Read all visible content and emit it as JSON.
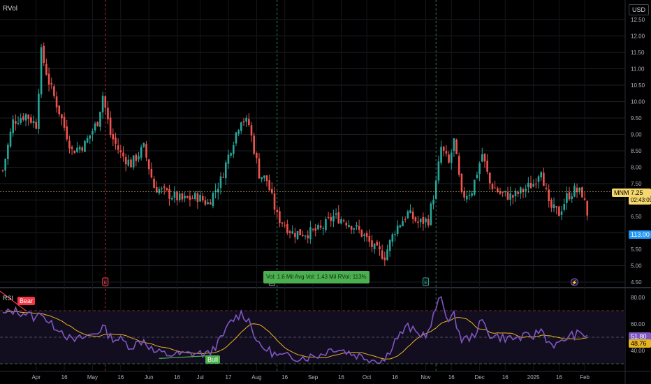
{
  "indicator_labels": {
    "main": "RVol",
    "sub": "RSI"
  },
  "currency": "USD",
  "price_tag": {
    "symbol": "MNMD",
    "price": "7.25",
    "countdown": "02:43:09",
    "color": "#f5d76e"
  },
  "volume_tag": {
    "value": "113.00",
    "color": "#2196f3"
  },
  "rvol_box": {
    "text": "Vol: 1.6 Mil   Avg Vol: 1.43 Mil   RVol: 113%",
    "color": "#4caf50"
  },
  "rsi_tags": {
    "value": "51.80",
    "ma": "48.76",
    "value_color": "#7e57c2",
    "ma_color": "#e6b422"
  },
  "annotations": {
    "bear": "Bear",
    "bull": "Bull",
    "bear_color": "#f23645",
    "bull_color": "#4caf50"
  },
  "event_markers": [
    {
      "kind": "earnings",
      "glyph": "E",
      "color": "#f23645",
      "index": 40
    },
    {
      "kind": "earnings",
      "glyph": "E",
      "color": "#9598a1",
      "index": 105
    },
    {
      "kind": "earnings",
      "glyph": "E",
      "color": "#26a69a",
      "index": 165
    },
    {
      "kind": "split",
      "glyph": "⚡",
      "color": "#7e57c2",
      "index": 223
    }
  ],
  "chart_data": {
    "type": "candlestick",
    "price_axis": {
      "min": 4.5,
      "max": 12.5,
      "step": 0.5,
      "ticks": [
        "12.50",
        "12.00",
        "11.50",
        "11.00",
        "10.50",
        "10.00",
        "9.50",
        "9.00",
        "8.50",
        "8.00",
        "7.50",
        "7.00",
        "6.50",
        "6.00",
        "5.50",
        "5.00",
        "4.50"
      ]
    },
    "rsi_axis": {
      "ticks": [
        "80.00",
        "60.00",
        "40.00"
      ],
      "levels": [
        70,
        50,
        30
      ],
      "min": 20,
      "max": 85
    },
    "time_labels": [
      {
        "text": "Apr",
        "index": 13
      },
      {
        "text": "16",
        "index": 24
      },
      {
        "text": "May",
        "index": 35
      },
      {
        "text": "16",
        "index": 46
      },
      {
        "text": "Jun",
        "index": 57
      },
      {
        "text": "16",
        "index": 68
      },
      {
        "text": "Jul",
        "index": 77
      },
      {
        "text": "17",
        "index": 88
      },
      {
        "text": "Aug",
        "index": 99
      },
      {
        "text": "16",
        "index": 110
      },
      {
        "text": "Sep",
        "index": 121
      },
      {
        "text": "16",
        "index": 132
      },
      {
        "text": "Oct",
        "index": 142
      },
      {
        "text": "16",
        "index": 153
      },
      {
        "text": "Nov",
        "index": 165
      },
      {
        "text": "16",
        "index": 175
      },
      {
        "text": "Dec",
        "index": 186
      },
      {
        "text": "16",
        "index": 196
      },
      {
        "text": "2025",
        "index": 207
      },
      {
        "text": "16",
        "index": 217
      },
      {
        "text": "Feb",
        "index": 227
      }
    ],
    "period_lines": [
      40,
      107,
      169
    ],
    "anchors": [
      [
        0,
        7.9
      ],
      [
        4,
        9.4
      ],
      [
        9,
        9.6
      ],
      [
        13,
        9.3
      ],
      [
        15,
        11.5
      ],
      [
        18,
        10.6
      ],
      [
        22,
        9.7
      ],
      [
        27,
        8.5
      ],
      [
        32,
        8.7
      ],
      [
        37,
        9.4
      ],
      [
        39,
        10.2
      ],
      [
        42,
        9.0
      ],
      [
        46,
        8.4
      ],
      [
        50,
        8.1
      ],
      [
        55,
        8.6
      ],
      [
        59,
        7.4
      ],
      [
        64,
        7.2
      ],
      [
        70,
        7.0
      ],
      [
        76,
        7.1
      ],
      [
        80,
        6.9
      ],
      [
        85,
        7.6
      ],
      [
        89,
        8.6
      ],
      [
        93,
        9.5
      ],
      [
        96,
        9.3
      ],
      [
        100,
        7.8
      ],
      [
        103,
        7.6
      ],
      [
        107,
        6.5
      ],
      [
        113,
        6.0
      ],
      [
        119,
        6.0
      ],
      [
        124,
        6.1
      ],
      [
        129,
        6.5
      ],
      [
        133,
        6.4
      ],
      [
        137,
        6.2
      ],
      [
        141,
        5.9
      ],
      [
        145,
        5.5
      ],
      [
        149,
        5.3
      ],
      [
        153,
        6.1
      ],
      [
        158,
        6.6
      ],
      [
        162,
        6.3
      ],
      [
        166,
        6.4
      ],
      [
        169,
        7.5
      ],
      [
        171,
        8.6
      ],
      [
        174,
        8.1
      ],
      [
        176,
        8.8
      ],
      [
        179,
        7.1
      ],
      [
        183,
        7.3
      ],
      [
        187,
        8.4
      ],
      [
        190,
        7.5
      ],
      [
        194,
        7.2
      ],
      [
        199,
        7.1
      ],
      [
        203,
        7.3
      ],
      [
        207,
        7.5
      ],
      [
        210,
        8.0
      ],
      [
        213,
        6.8
      ],
      [
        217,
        6.6
      ],
      [
        220,
        7.1
      ],
      [
        223,
        7.3
      ],
      [
        226,
        7.2
      ],
      [
        228,
        6.6
      ]
    ],
    "rsi_anchors": [
      [
        0,
        67
      ],
      [
        4,
        70
      ],
      [
        9,
        68
      ],
      [
        13,
        64
      ],
      [
        15,
        70
      ],
      [
        18,
        60
      ],
      [
        22,
        57
      ],
      [
        27,
        47
      ],
      [
        32,
        50
      ],
      [
        37,
        54
      ],
      [
        39,
        58
      ],
      [
        42,
        50
      ],
      [
        46,
        48
      ],
      [
        50,
        43
      ],
      [
        55,
        48
      ],
      [
        59,
        39
      ],
      [
        64,
        37
      ],
      [
        70,
        37
      ],
      [
        76,
        38
      ],
      [
        80,
        37
      ],
      [
        85,
        48
      ],
      [
        89,
        62
      ],
      [
        93,
        68
      ],
      [
        96,
        63
      ],
      [
        100,
        43
      ],
      [
        103,
        41
      ],
      [
        107,
        36
      ],
      [
        113,
        35
      ],
      [
        119,
        35
      ],
      [
        124,
        37
      ],
      [
        129,
        42
      ],
      [
        133,
        40
      ],
      [
        137,
        37
      ],
      [
        141,
        35
      ],
      [
        145,
        33
      ],
      [
        149,
        33
      ],
      [
        153,
        48
      ],
      [
        158,
        58
      ],
      [
        162,
        52
      ],
      [
        166,
        53
      ],
      [
        169,
        72
      ],
      [
        171,
        80
      ],
      [
        174,
        62
      ],
      [
        176,
        66
      ],
      [
        179,
        48
      ],
      [
        183,
        50
      ],
      [
        187,
        62
      ],
      [
        190,
        52
      ],
      [
        194,
        50
      ],
      [
        199,
        49
      ],
      [
        203,
        50
      ],
      [
        207,
        51
      ],
      [
        210,
        56
      ],
      [
        213,
        46
      ],
      [
        217,
        44
      ],
      [
        220,
        50
      ],
      [
        223,
        52
      ],
      [
        226,
        52
      ],
      [
        228,
        51.8
      ]
    ]
  }
}
